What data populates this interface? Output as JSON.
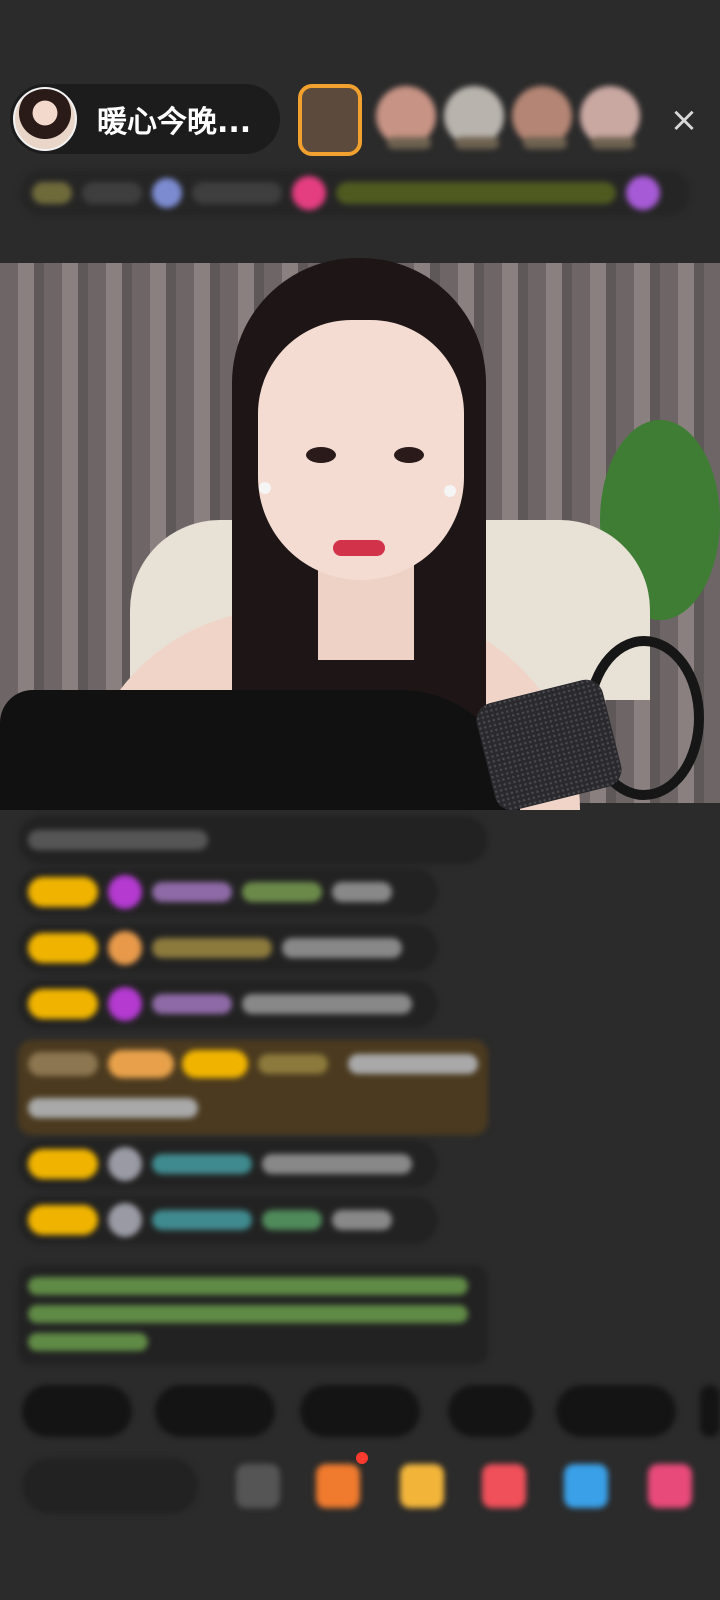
{
  "host": {
    "name": "暖心今晚..."
  },
  "close_glyph": "×",
  "colors": {
    "background": "#2b2b2b",
    "level_badge": "#f0b400",
    "highlight_message": "#4b3a1f"
  }
}
